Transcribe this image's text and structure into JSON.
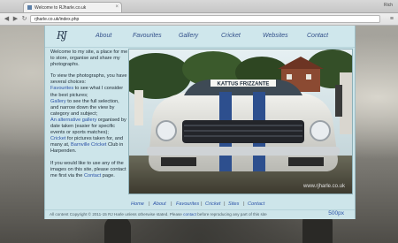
{
  "browser": {
    "tab_title": "Welcome to RJharle.co.uk",
    "tab_close": "×",
    "user": "Rich",
    "url": "rjharle.co.uk/index.php",
    "back": "◀",
    "forward": "▶",
    "reload": "↻",
    "menu": "≡"
  },
  "site": {
    "logo": "RJ",
    "nav": [
      {
        "label": "About"
      },
      {
        "label": "Favourites"
      },
      {
        "label": "Gallery"
      },
      {
        "label": "Cricket"
      },
      {
        "label": "Websites"
      },
      {
        "label": "Contact"
      }
    ],
    "intro": {
      "p1": "Welcome to my site, a place for me to store, organise and share my photographs.",
      "p2_lead": "To view the photographs, you have several choices:",
      "fav_link": "Favourites",
      "fav_text": " to see what I consider the best pictures;",
      "gal_link": "Gallery",
      "gal_text": " to see the full selection, and narrow down the view by category and subject;",
      "alt_link": "An alternative gallery",
      "alt_text": " organised by date taken (easier for specific events or sports matches);",
      "cricket_link": "Cricket",
      "cricket_text": " for pictures taken for, and many at, ",
      "club_link": "Barnville Cricket",
      "club_text": " Club in Harpenden.",
      "p3_lead": "If you would like to use any of the images on this site, please contact me first via the ",
      "contact_link": "Contact",
      "p3_end": " page."
    },
    "photo": {
      "banner": "KATTUS FRIZZANTE",
      "watermark": "www.rjharle.co.uk"
    },
    "footer_nav": [
      {
        "label": "Home"
      },
      {
        "label": "About"
      },
      {
        "label": "Favourites"
      },
      {
        "label": "Cricket"
      },
      {
        "label": "Sites"
      },
      {
        "label": "Contact"
      }
    ],
    "footer_sep": "|",
    "copyright_a": "All content Copyright © 2011-15 RJ Harle unless otherwise stated. Please ",
    "copyright_link": "contact",
    "copyright_b": " before reproducing any part of this site",
    "px_badge": "500px"
  }
}
